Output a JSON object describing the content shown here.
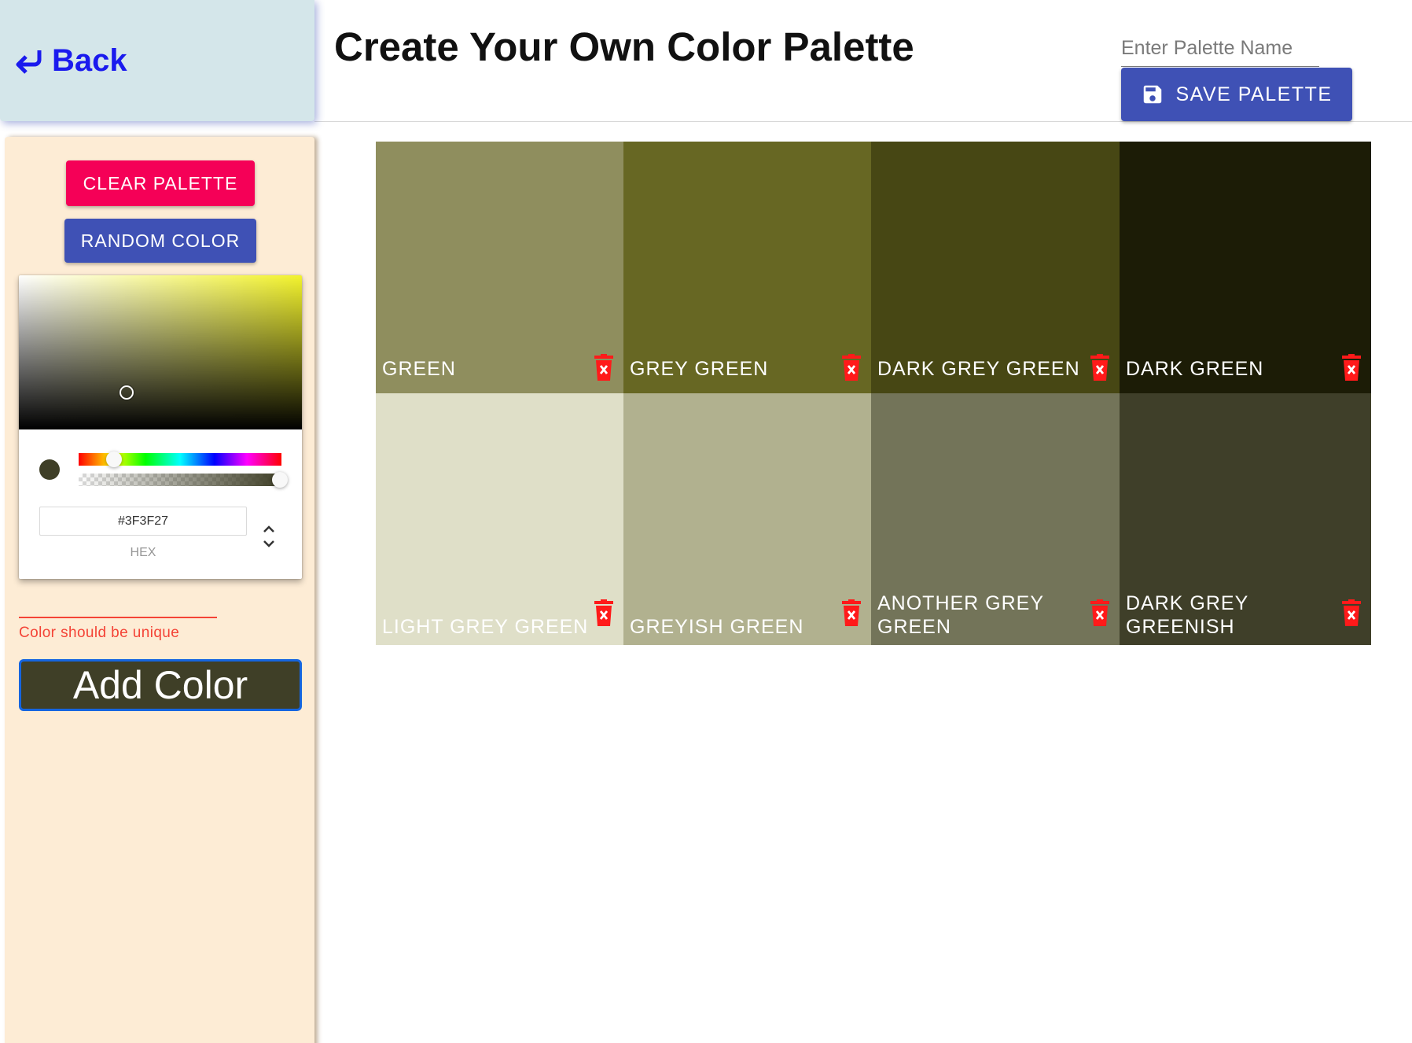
{
  "nav": {
    "back_label": "Back"
  },
  "header": {
    "title": "Create Your Own Color Palette",
    "palette_name_placeholder": "Enter Palette Name",
    "save_label": "SAVE PALETTE"
  },
  "sidebar": {
    "clear_label": "CLEAR PALETTE",
    "random_label": "RANDOM COLOR",
    "picker": {
      "hex_value": "#3F3F27",
      "mode_label": "HEX",
      "current_color": "#3F3F27",
      "hue_color": "#f3f32d"
    },
    "color_name_value": "",
    "error_text": "Color should be unique",
    "add_label": "Add Color"
  },
  "palette": {
    "colors": [
      {
        "name": "Green",
        "hex": "#8f8e5e",
        "text_color": "#ffffff"
      },
      {
        "name": "Grey Green",
        "hex": "#676723",
        "text_color": "#ffffff"
      },
      {
        "name": "Dark Grey Green",
        "hex": "#474714",
        "text_color": "#ffffff"
      },
      {
        "name": "Dark Green",
        "hex": "#1c1c06",
        "text_color": "#ffffff"
      },
      {
        "name": "Light Grey Green",
        "hex": "#dfdfc8",
        "text_color": "#ffffff"
      },
      {
        "name": "Greyish Green",
        "hex": "#b1b18f",
        "text_color": "#ffffff"
      },
      {
        "name": "Another Grey Green",
        "hex": "#737459",
        "text_color": "#ffffff"
      },
      {
        "name": "Dark Grey Greenish",
        "hex": "#3f3f29",
        "text_color": "#ffffff"
      }
    ]
  },
  "colors": {
    "accent_primary": "#3f51b5",
    "accent_secondary": "#f50057",
    "error": "#f44336",
    "trash": "#ff1a1a"
  }
}
